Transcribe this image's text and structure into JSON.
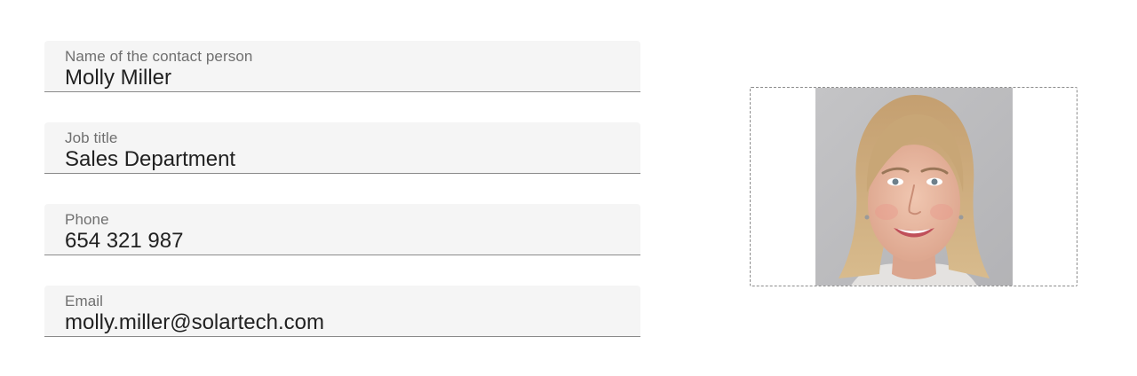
{
  "contact_form": {
    "name": {
      "label": "Name of the contact person",
      "value": "Molly Miller"
    },
    "job_title": {
      "label": "Job title",
      "value": "Sales Department"
    },
    "phone": {
      "label": "Phone",
      "value": "654 321 987"
    },
    "email": {
      "label": "Email",
      "value": "molly.miller@solartech.com"
    }
  },
  "photo": {
    "alt": "Contact person photo",
    "background_color": "#bcbcbe",
    "hair_color": "#c9a878",
    "skin_color": "#e9b9a2"
  }
}
